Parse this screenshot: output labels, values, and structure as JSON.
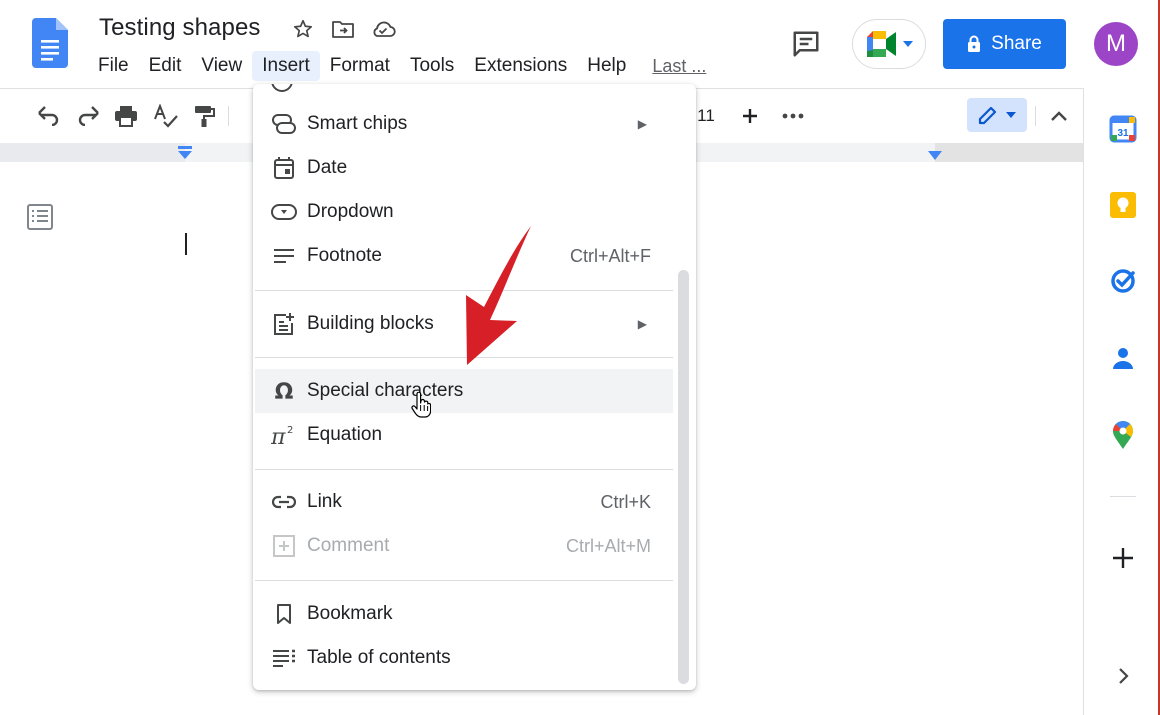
{
  "document": {
    "title": "Testing shapes"
  },
  "menubar": {
    "items": [
      "File",
      "Edit",
      "View",
      "Insert",
      "Format",
      "Tools",
      "Extensions",
      "Help"
    ],
    "active": "Insert",
    "last_edit": "Last ..."
  },
  "header": {
    "share_label": "Share",
    "avatar_letter": "M"
  },
  "toolbar": {
    "font_size": "11"
  },
  "insert_menu": {
    "items": [
      {
        "label": "Smart chips",
        "icon": "smart-chips-icon",
        "submenu": true
      },
      {
        "label": "Date",
        "icon": "calendar-icon"
      },
      {
        "label": "Dropdown",
        "icon": "dropdown-icon"
      },
      {
        "label": "Footnote",
        "icon": "footnote-icon",
        "shortcut": "Ctrl+Alt+F"
      },
      {
        "label": "Building blocks",
        "icon": "building-blocks-icon",
        "submenu": true
      },
      {
        "label": "Special characters",
        "icon": "omega-icon",
        "hovered": true
      },
      {
        "label": "Equation",
        "icon": "pi-icon"
      },
      {
        "label": "Link",
        "icon": "link-icon",
        "shortcut": "Ctrl+K"
      },
      {
        "label": "Comment",
        "icon": "add-comment-icon",
        "shortcut": "Ctrl+Alt+M",
        "disabled": true
      },
      {
        "label": "Bookmark",
        "icon": "bookmark-icon"
      },
      {
        "label": "Table of contents",
        "icon": "toc-icon"
      }
    ]
  },
  "colors": {
    "accent": "#1a73e8",
    "avatar": "#9c45c7",
    "annotation_arrow": "#d61f26",
    "menu_hover": "#f1f3f4"
  }
}
